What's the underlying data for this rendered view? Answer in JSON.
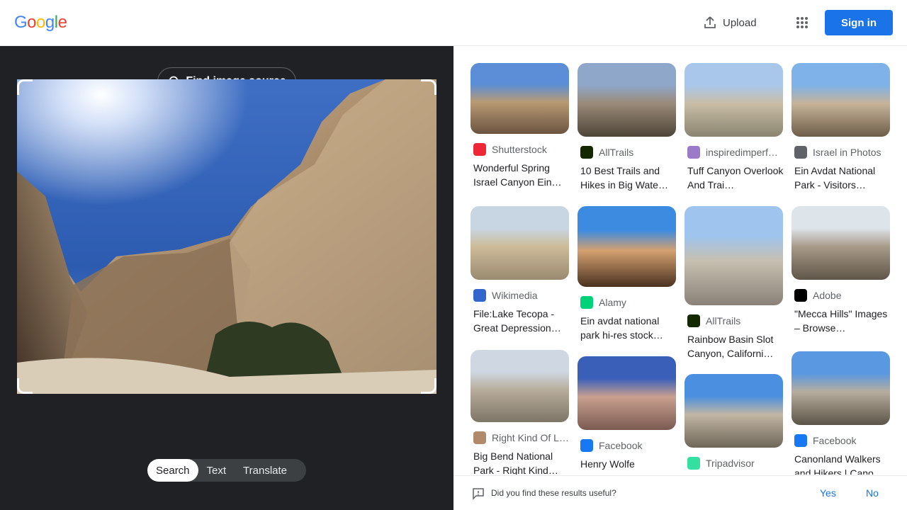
{
  "header": {
    "logo_letters": [
      "G",
      "o",
      "o",
      "g",
      "l",
      "e"
    ],
    "logo_colors": [
      "#4285f4",
      "#ea4335",
      "#fbbc05",
      "#4285f4",
      "#34a853",
      "#ea4335"
    ],
    "upload_label": "Upload",
    "signin_label": "Sign in",
    "accent": "#1a73e8"
  },
  "lens": {
    "find_source_label": "Find image source",
    "modes": [
      "Search",
      "Text",
      "Translate"
    ],
    "active_mode": "Search"
  },
  "results": [
    {
      "source": "Shutterstock",
      "favicon": "shutterstock-icon",
      "favicon_color": "#ee2737",
      "title": "Wonderful Spring Israel Canyon Ein…"
    },
    {
      "source": "AllTrails",
      "favicon": "alltrails-icon",
      "favicon_color": "#142800",
      "title": "10 Best Trails and Hikes in Big Wate…"
    },
    {
      "source": "inspiredimperf…",
      "favicon": "heart-icon",
      "favicon_color": "#9b7bc7",
      "title": "Tuff Canyon Overlook And Trai…"
    },
    {
      "source": "Israel in Photos",
      "favicon": "news-icon",
      "favicon_color": "#5f6368",
      "title": "Ein Avdat National Park - Visitors…"
    },
    {
      "source": "Wikimedia",
      "favicon": "wikimedia-icon",
      "favicon_color": "#3366cc",
      "title": "File:Lake Tecopa - Great Depression…"
    },
    {
      "source": "Alamy",
      "favicon": "alamy-icon",
      "favicon_color": "#00d27a",
      "title": "Ein avdat national park hi-res stock…"
    },
    {
      "source": "AllTrails",
      "favicon": "alltrails-icon",
      "favicon_color": "#142800",
      "title": "Rainbow Basin Slot Canyon, Californi…"
    },
    {
      "source": "Adobe",
      "favicon": "adobe-stock-icon",
      "favicon_color": "#000000",
      "title": "\"Mecca Hills\" Images – Browse…"
    },
    {
      "source": "Right Kind Of L…",
      "favicon": "site-icon",
      "favicon_color": "#b08a6a",
      "title": "Big Bend National Park - Right Kind…"
    },
    {
      "source": "Facebook",
      "favicon": "facebook-icon",
      "favicon_color": "#1877f2",
      "title": "Henry Wolfe"
    },
    {
      "source": "Tripadvisor",
      "favicon": "tripadvisor-icon",
      "favicon_color": "#34e0a1",
      "title": ""
    },
    {
      "source": "Facebook",
      "favicon": "facebook-icon",
      "favicon_color": "#1877f2",
      "title": "Canonland Walkers and Hikers | Cano…"
    }
  ],
  "feedback": {
    "question": "Did you find these results useful?",
    "yes": "Yes",
    "no": "No"
  }
}
